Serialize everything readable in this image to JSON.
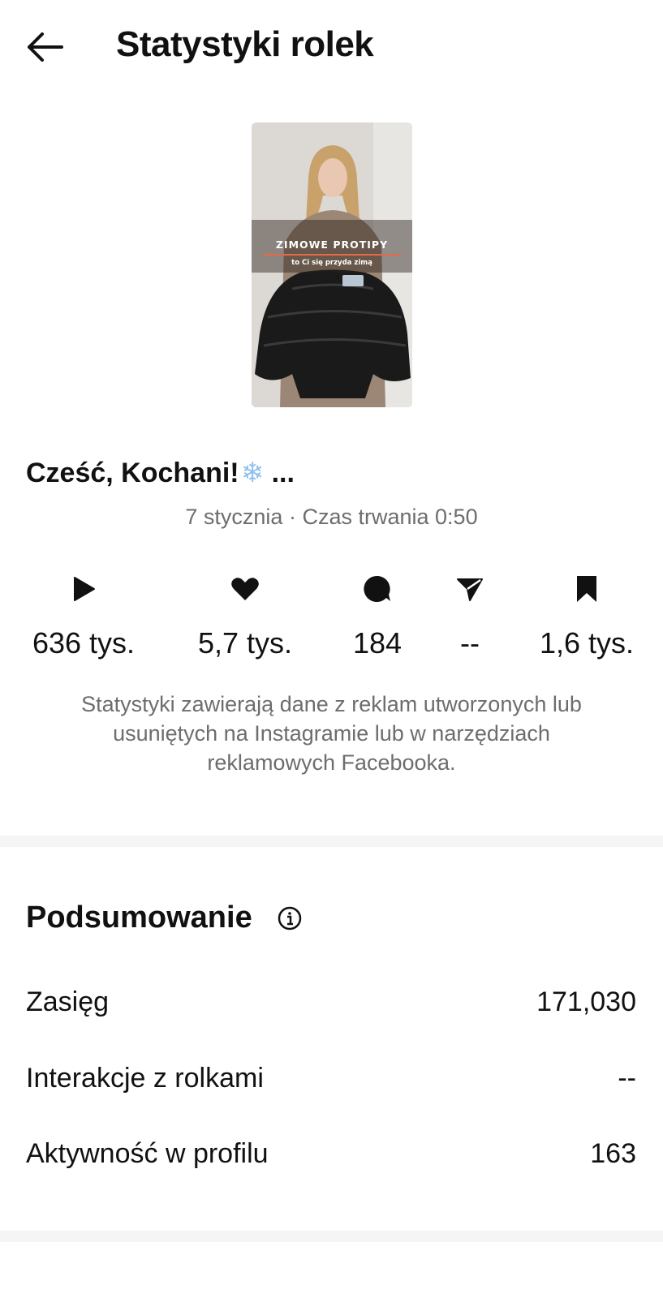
{
  "header": {
    "title": "Statystyki rolek"
  },
  "reel": {
    "thumbnail": {
      "title": "ZIMOWE PROTIPY",
      "subtitle": "to Ci się przyda zimą"
    },
    "caption": "Cześć, Kochani!",
    "caption_more": " ...",
    "date": "7 stycznia",
    "separator": "·",
    "duration": "Czas trwania 0:50"
  },
  "stats": [
    {
      "icon": "play-icon",
      "value": "636 tys."
    },
    {
      "icon": "heart-icon",
      "value": "5,7 tys."
    },
    {
      "icon": "comment-icon",
      "value": "184"
    },
    {
      "icon": "share-icon",
      "value": "--"
    },
    {
      "icon": "bookmark-icon",
      "value": "1,6 tys."
    }
  ],
  "disclaimer": "Statystyki zawierają dane z reklam utworzonych lub usuniętych na Instagramie lub w narzędziach reklamowych Facebooka.",
  "summary": {
    "title": "Podsumowanie",
    "rows": [
      {
        "label": "Zasięg",
        "value": "171,030"
      },
      {
        "label": "Interakcje z rolkami",
        "value": "--"
      },
      {
        "label": "Aktywność w profilu",
        "value": "163"
      }
    ]
  },
  "colors": {
    "muted_text": "#6d6d6d",
    "divider": "#f5f5f5",
    "accent_line": "#e46a4a",
    "snowflake": "#8fc1f0"
  }
}
